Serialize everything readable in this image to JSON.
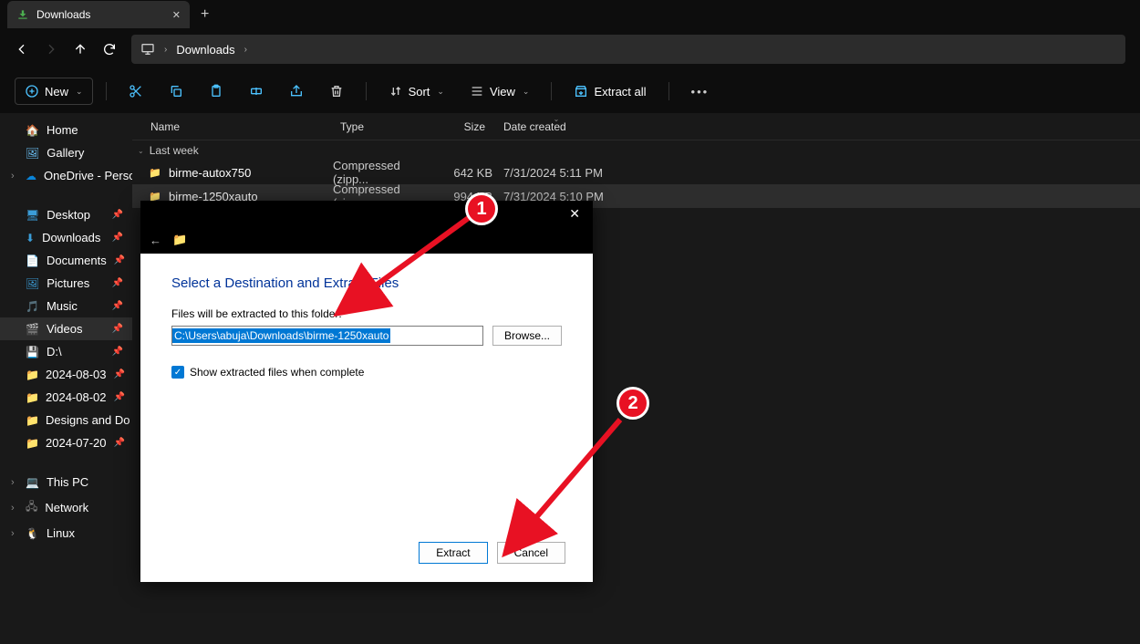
{
  "tab": {
    "title": "Downloads"
  },
  "breadcrumb": {
    "location": "Downloads"
  },
  "toolbar": {
    "new_label": "New",
    "sort_label": "Sort",
    "view_label": "View",
    "extract_all_label": "Extract all"
  },
  "columns": {
    "name": "Name",
    "type": "Type",
    "size": "Size",
    "date": "Date created"
  },
  "group_label": "Last week",
  "files": [
    {
      "name": "birme-autox750",
      "type": "Compressed (zipp...",
      "size": "642 KB",
      "date": "7/31/2024 5:11 PM",
      "selected": false
    },
    {
      "name": "birme-1250xauto",
      "type": "Compressed (zipp...",
      "size": "994 KB",
      "date": "7/31/2024 5:10 PM",
      "selected": true
    }
  ],
  "sidebar": {
    "home": "Home",
    "gallery": "Gallery",
    "onedrive": "OneDrive - Persona",
    "desktop": "Desktop",
    "downloads": "Downloads",
    "documents": "Documents",
    "pictures": "Pictures",
    "music": "Music",
    "videos": "Videos",
    "d_drive": "D:\\",
    "f1": "2024-08-03",
    "f2": "2024-08-02",
    "f3": "Designs and Do",
    "f4": "2024-07-20",
    "thispc": "This PC",
    "network": "Network",
    "linux": "Linux"
  },
  "dialog": {
    "title": "Select a Destination and Extract Files",
    "prompt": "Files will be extracted to this folder:",
    "path_value": "C:\\Users\\abuja\\Downloads\\birme-1250xauto",
    "browse": "Browse...",
    "checkbox_label": "Show extracted files when complete",
    "extract": "Extract",
    "cancel": "Cancel"
  },
  "annotations": {
    "one": "1",
    "two": "2"
  }
}
